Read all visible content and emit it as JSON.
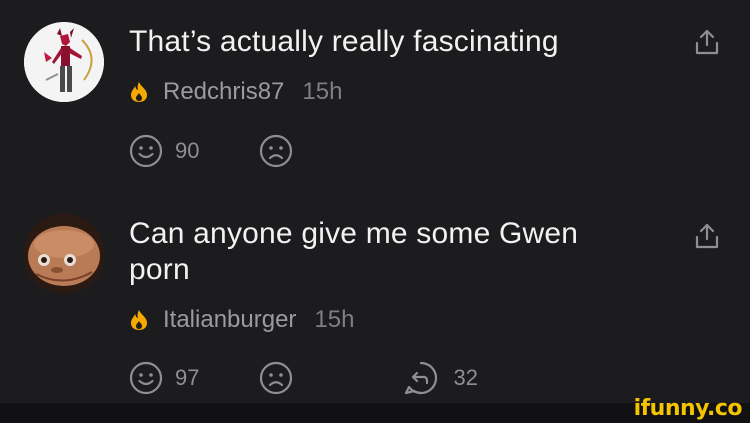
{
  "comments": [
    {
      "text": "That’s actually really fascinating",
      "username": "Redchris87",
      "time": "15h",
      "likes": "90"
    },
    {
      "text": "Can anyone give me some Gwen porn",
      "username": "Italianburger",
      "time": "15h",
      "likes": "97",
      "replies": "32"
    }
  ],
  "icons": {
    "flame_color": "#f5a800",
    "share": "share-icon",
    "smile": "smile-icon",
    "frown": "frown-icon",
    "reply": "reply-icon"
  },
  "watermark": "ifunny.co",
  "colors": {
    "background": "#1c1c1f",
    "text": "#f2f2f2",
    "meta": "#9a9aa0",
    "watermark": "#f5c400"
  }
}
